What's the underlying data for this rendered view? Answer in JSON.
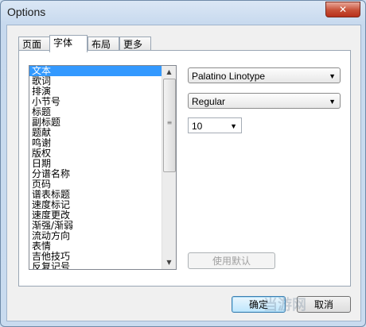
{
  "window": {
    "title": "Options",
    "close_glyph": "✕"
  },
  "tabs": [
    "页面",
    "字体",
    "布局",
    "更多"
  ],
  "active_tab": "字体",
  "list": {
    "items": [
      "文本",
      "歌词",
      "排演",
      "小节号",
      "标题",
      "副标题",
      "题献",
      "鸣谢",
      "版权",
      "日期",
      "分谱名称",
      "页码",
      "谱表标题",
      "速度标记",
      "速度更改",
      "渐强/渐弱",
      "流动方向",
      "表情",
      "吉他技巧",
      "反复记号"
    ],
    "selected": "文本"
  },
  "font_family": {
    "value": "Palatino Linotype"
  },
  "font_style": {
    "value": "Regular"
  },
  "font_size": {
    "value": "10"
  },
  "use_default_label": "使用默认",
  "ok_label": "确定",
  "cancel_label": "取消",
  "watermark_text": "当游网",
  "icons": {
    "combo_arrow": "▼",
    "scroll_up": "▲",
    "scroll_down": "▼",
    "grip": "≡"
  }
}
